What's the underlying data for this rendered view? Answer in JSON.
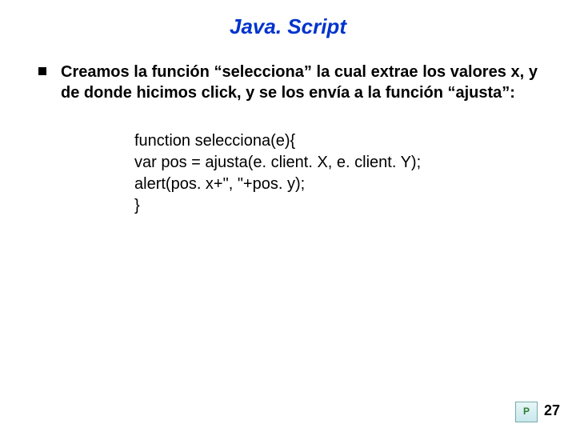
{
  "title": "Java. Script",
  "bullet": {
    "text": "Creamos la función “selecciona” la cual extrae los valores x, y de donde hicimos click, y se los envía a la función “ajusta”:"
  },
  "code": {
    "line1": "function selecciona(e){",
    "line2": "var pos = ajusta(e. client. X, e. client. Y);",
    "line3": "alert(pos. x+\", \"+pos. y);",
    "line4": "}"
  },
  "page_number": "27",
  "logo_text": "P"
}
